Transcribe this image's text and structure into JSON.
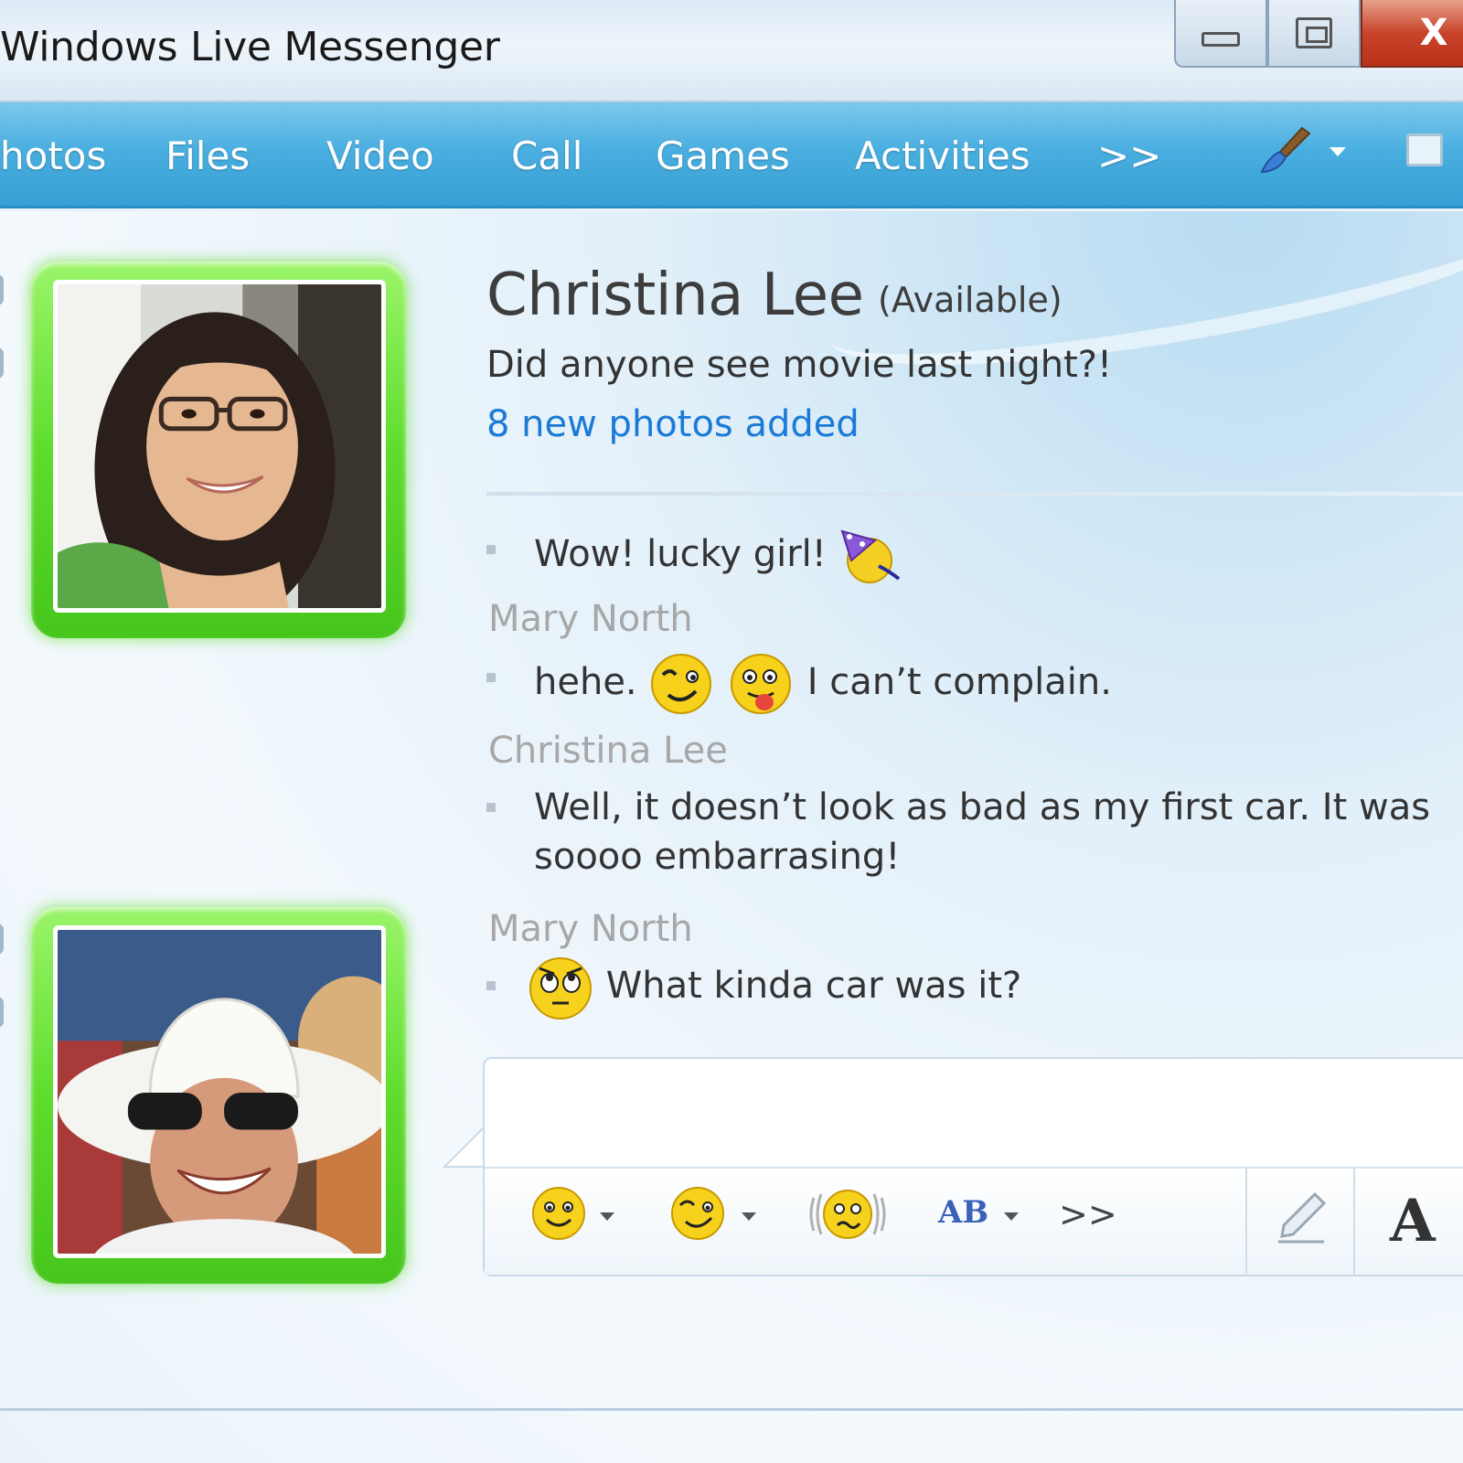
{
  "window": {
    "title": "Windows Live Messenger",
    "controls": [
      "minimize-icon",
      "maximize-icon",
      "close-icon"
    ],
    "close_glyph": "X"
  },
  "toolbar": {
    "items": [
      "hotos",
      "Files",
      "Video",
      "Call",
      "Games",
      "Activities"
    ],
    "more": ">>"
  },
  "contact": {
    "name": "Christina Lee",
    "status": "(Available)",
    "personal_message": "Did anyone see movie last night?!",
    "link": "8 new photos added"
  },
  "conversation": {
    "lines": [
      {
        "text": "Wow! lucky girl!",
        "emoticon": "party-icon"
      },
      {
        "sender": "Mary North"
      },
      {
        "text_before": "hehe.",
        "emoticons": [
          "wink-icon",
          "tongue-icon"
        ],
        "text_after": "I can’t complain."
      },
      {
        "sender": "Christina Lee"
      },
      {
        "text_line1": "Well, it doesn’t look as bad as my first car. It was",
        "text_line2": "soooo embarrasing!"
      },
      {
        "sender": "Mary North"
      },
      {
        "emoticon": "eye-roll-icon",
        "text": "What kinda car was it?"
      }
    ]
  },
  "input_toolbar": {
    "more": ">>",
    "ab_label": "AB",
    "font_label": "A"
  },
  "colors": {
    "toolbar": "#4aafe0",
    "avatar_frame": "#5fdd2e",
    "link": "#1a7ad6",
    "sender": "#a7a7a7"
  }
}
